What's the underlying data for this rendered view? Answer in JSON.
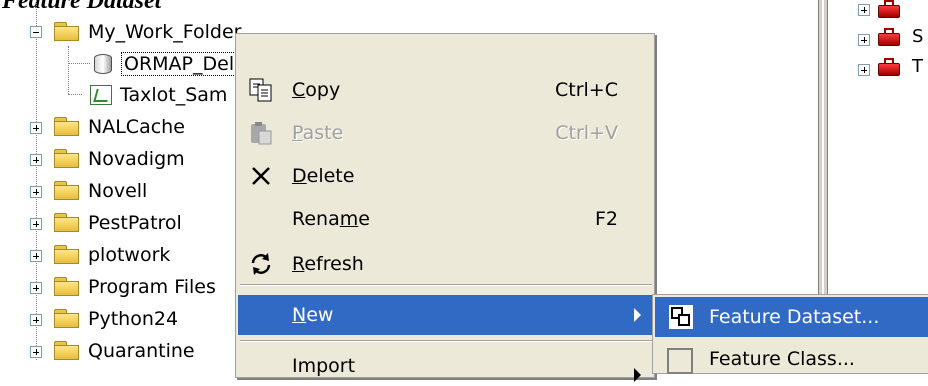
{
  "doc_title": "Feature Dataset",
  "tree": {
    "items": [
      {
        "label": "My_Work_Folder"
      },
      {
        "label": "ORMAP_Deliverable.mdb"
      },
      {
        "label": "Taxlot_Sam"
      },
      {
        "label": "NALCache"
      },
      {
        "label": "Novadigm"
      },
      {
        "label": "Novell"
      },
      {
        "label": "PestPatrol"
      },
      {
        "label": "plotwork"
      },
      {
        "label": "Program Files"
      },
      {
        "label": "Python24"
      },
      {
        "label": "Quarantine"
      }
    ]
  },
  "right_pane": {
    "items": [
      "",
      "S",
      "T"
    ]
  },
  "context_menu": {
    "copy": {
      "label": "Copy",
      "accel": "C",
      "shortcut": "Ctrl+C"
    },
    "paste": {
      "label": "Paste",
      "accel": "P",
      "shortcut": "Ctrl+V"
    },
    "delete": {
      "label": "Delete",
      "accel": "D"
    },
    "rename": {
      "label": "Rename",
      "accel": "m",
      "shortcut": "F2"
    },
    "refresh": {
      "label": "Refresh",
      "accel": "R"
    },
    "new": {
      "label": "New",
      "accel": "N"
    },
    "import": {
      "label": "Import"
    }
  },
  "submenu": {
    "feature_dataset": "Feature Dataset...",
    "feature_class": "Feature Class..."
  },
  "colors": {
    "selection": "#316ac5",
    "menu_bg": "#ece9d8",
    "folder": "#f2d064"
  }
}
